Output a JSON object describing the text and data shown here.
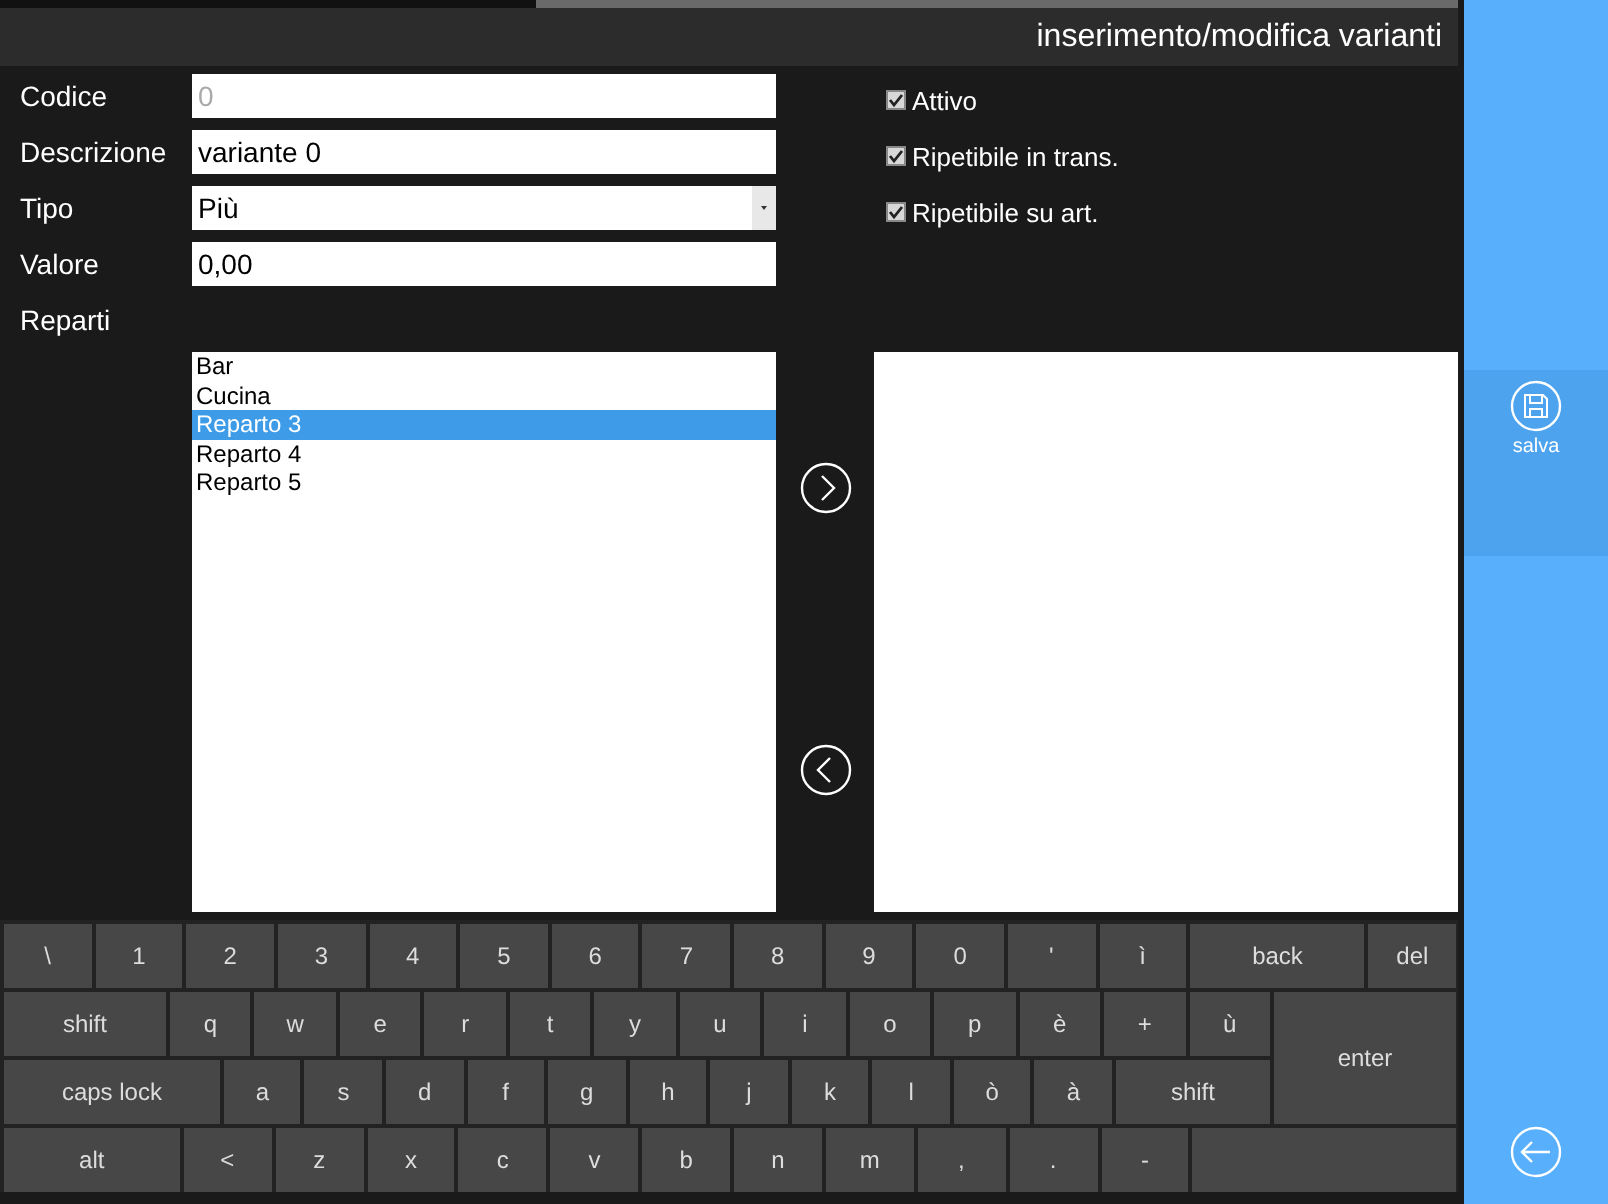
{
  "window": {
    "title": "inserimento/modifica varianti"
  },
  "fields": [
    {
      "label": "Codice",
      "placeholder": "0",
      "kind": "text"
    },
    {
      "label": "Descrizione",
      "value": "variante 0",
      "kind": "text"
    },
    {
      "label": "Tipo",
      "value": "Più",
      "kind": "select"
    },
    {
      "label": "Valore",
      "value": "0,00",
      "kind": "text"
    }
  ],
  "checkboxes": [
    {
      "label": "Attivo",
      "checked": true
    },
    {
      "label": "Ripetibile in trans.",
      "checked": true
    },
    {
      "label": "Ripetibile su art.",
      "checked": true
    }
  ],
  "reparti": {
    "label": "Reparti",
    "available": [
      {
        "label": "Bar",
        "selected": false
      },
      {
        "label": "Cucina",
        "selected": false
      },
      {
        "label": "Reparto 3",
        "selected": true
      },
      {
        "label": "Reparto 4",
        "selected": false
      },
      {
        "label": "Reparto 5",
        "selected": false
      }
    ]
  },
  "sidebar": {
    "items": [
      {
        "label": "salva",
        "kind": "save",
        "selected": true
      }
    ]
  },
  "keyboard": {
    "rows": [
      {
        "keys": [
          {
            "label": "\\",
            "kind": "char"
          },
          {
            "label": "1",
            "kind": "char"
          },
          {
            "label": "2",
            "kind": "char"
          },
          {
            "label": "3",
            "kind": "char"
          },
          {
            "label": "4",
            "kind": "char"
          },
          {
            "label": "5",
            "kind": "char"
          },
          {
            "label": "6",
            "kind": "char"
          },
          {
            "label": "7",
            "kind": "char"
          },
          {
            "label": "8",
            "kind": "char"
          },
          {
            "label": "9",
            "kind": "char"
          },
          {
            "label": "0",
            "kind": "char"
          },
          {
            "label": "'",
            "kind": "char"
          },
          {
            "label": "ì",
            "kind": "char"
          },
          {
            "label": "back",
            "kind": "wide"
          },
          {
            "label": "del",
            "kind": "char"
          }
        ]
      },
      {
        "keys": [
          {
            "label": "shift",
            "kind": "wide"
          },
          {
            "label": "q",
            "kind": "char"
          },
          {
            "label": "w",
            "kind": "char"
          },
          {
            "label": "e",
            "kind": "char"
          },
          {
            "label": "r",
            "kind": "char"
          },
          {
            "label": "t",
            "kind": "char"
          },
          {
            "label": "y",
            "kind": "char"
          },
          {
            "label": "u",
            "kind": "char"
          },
          {
            "label": "i",
            "kind": "char"
          },
          {
            "label": "o",
            "kind": "char"
          },
          {
            "label": "p",
            "kind": "char"
          },
          {
            "label": "è",
            "kind": "char"
          },
          {
            "label": "+",
            "kind": "char"
          },
          {
            "label": "ù",
            "kind": "char"
          },
          {
            "label": "enter",
            "kind": "enter"
          }
        ]
      },
      {
        "keys": [
          {
            "label": "caps lock",
            "kind": "caps"
          },
          {
            "label": "a",
            "kind": "char"
          },
          {
            "label": "s",
            "kind": "char"
          },
          {
            "label": "d",
            "kind": "char"
          },
          {
            "label": "f",
            "kind": "char"
          },
          {
            "label": "g",
            "kind": "char"
          },
          {
            "label": "h",
            "kind": "char"
          },
          {
            "label": "j",
            "kind": "char"
          },
          {
            "label": "k",
            "kind": "char"
          },
          {
            "label": "l",
            "kind": "char"
          },
          {
            "label": "ò",
            "kind": "char"
          },
          {
            "label": "à",
            "kind": "char"
          },
          {
            "label": "shift",
            "kind": "wide"
          }
        ]
      },
      {
        "keys": [
          {
            "label": "alt",
            "kind": "wide"
          },
          {
            "label": "<",
            "kind": "char"
          },
          {
            "label": "z",
            "kind": "char"
          },
          {
            "label": "x",
            "kind": "char"
          },
          {
            "label": "c",
            "kind": "char"
          },
          {
            "label": "v",
            "kind": "char"
          },
          {
            "label": "b",
            "kind": "char"
          },
          {
            "label": "n",
            "kind": "char"
          },
          {
            "label": "m",
            "kind": "char"
          },
          {
            "label": ",",
            "kind": "char"
          },
          {
            "label": ".",
            "kind": "char"
          },
          {
            "label": "-",
            "kind": "char"
          },
          {
            "kind": "space"
          }
        ]
      }
    ]
  }
}
